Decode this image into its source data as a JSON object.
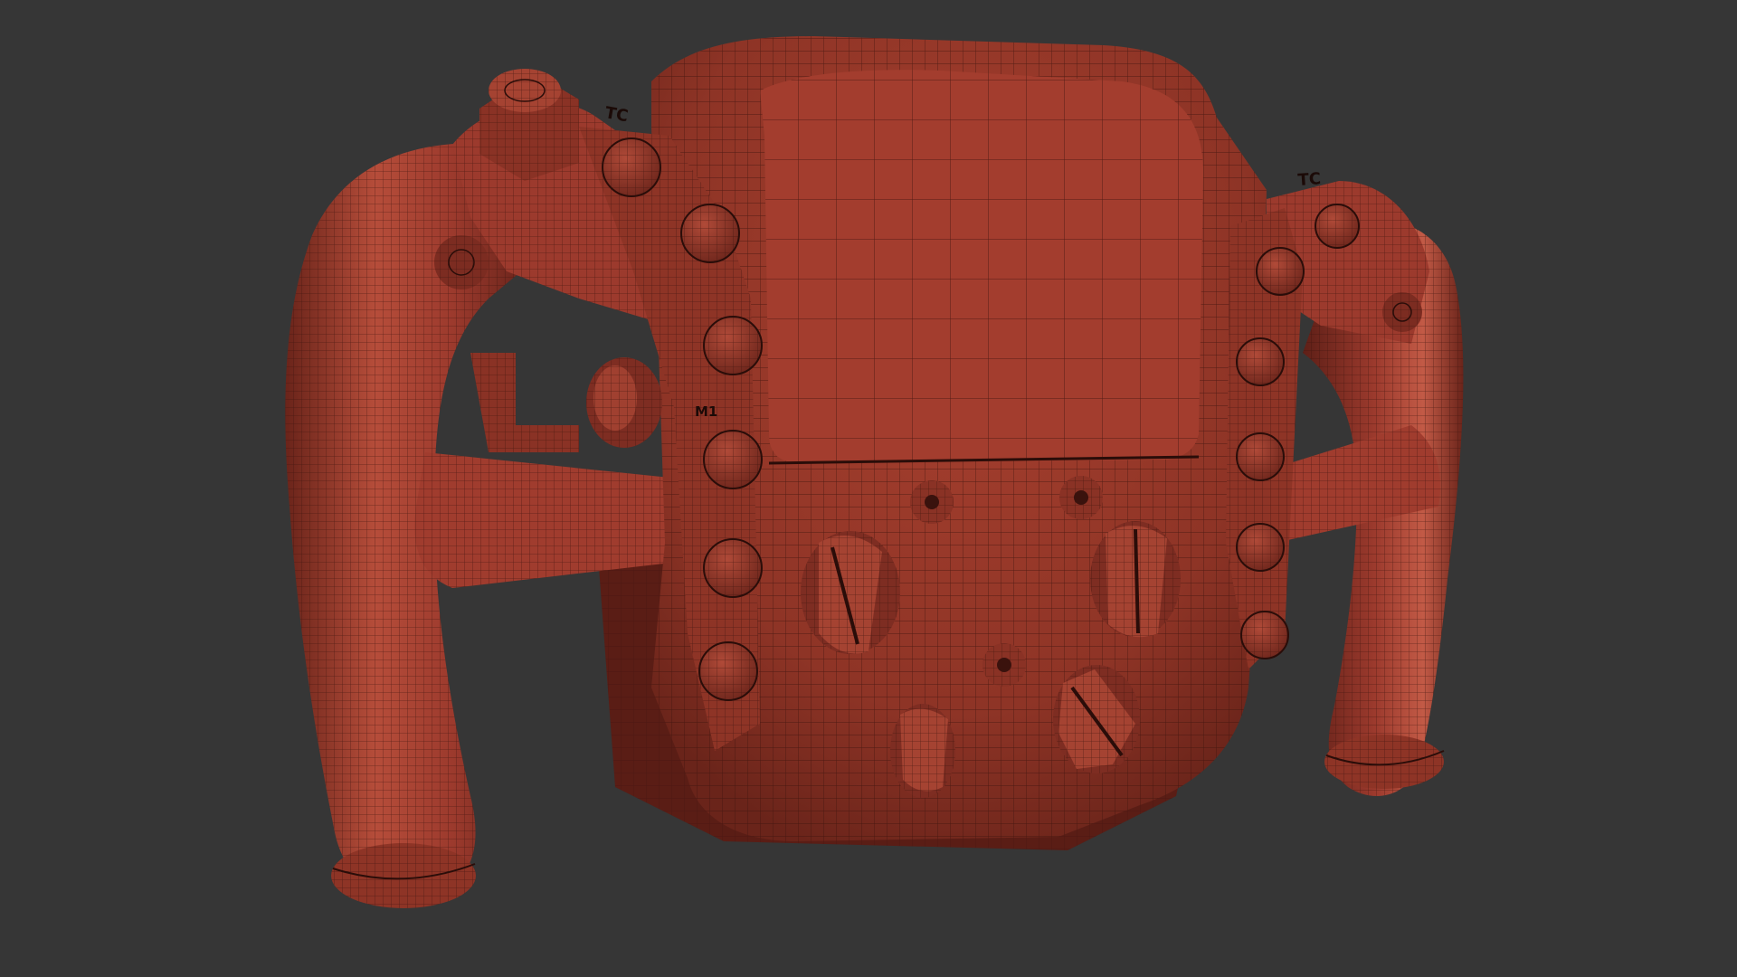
{
  "scene": {
    "background_color": "#363636",
    "model_color": "#9c3a2d",
    "model_highlight": "#c25a46",
    "model_shadow": "#5e1f17",
    "wire_color": "#3a120d",
    "render_mode": "wireframe-on-shaded"
  },
  "labels": {
    "tc_left": "TC",
    "tc_right": "TC",
    "m1": "M1"
  }
}
